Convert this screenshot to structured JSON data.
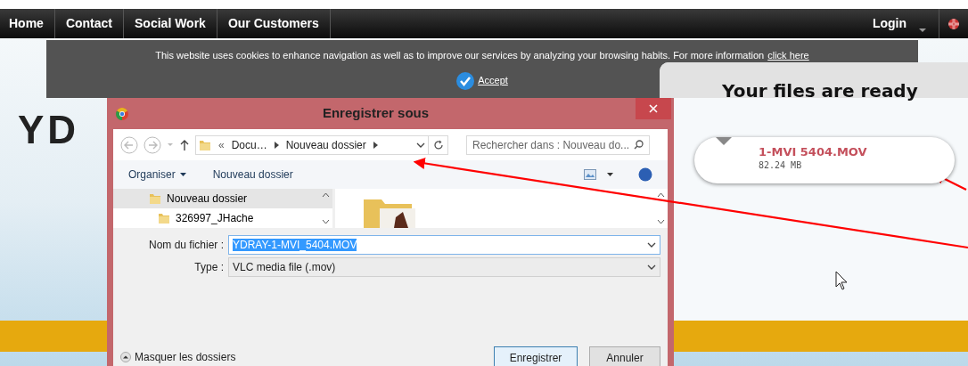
{
  "nav": {
    "items": [
      {
        "label": "Home"
      },
      {
        "label": "Contact"
      },
      {
        "label": "Social Work"
      },
      {
        "label": "Our Customers"
      }
    ],
    "login": "Login"
  },
  "logo": {
    "text": "YD"
  },
  "cookie_banner": {
    "text": "This website uses cookies to enhance navigation as well as to improve our services by analyzing your browsing habits. For more information",
    "link": "click here",
    "accept": "Accept"
  },
  "download_card": {
    "title": "Your files are ready",
    "file_name": "1-MVI 5404.MOV",
    "size": "82.24 MB"
  },
  "dialog": {
    "title": "Enregistrer sous",
    "address_bar": {
      "overflow": "«",
      "path": [
        "Docu…",
        "Nouveau dossier"
      ]
    },
    "search": {
      "placeholder": "Rechercher dans : Nouveau do..."
    },
    "toolbar": {
      "organize": "Organiser",
      "new_folder": "Nouveau dossier"
    },
    "tree": [
      {
        "label": "Nouveau dossier",
        "selected": true,
        "children": [
          {
            "label": "326997_JHache",
            "selected": false
          }
        ]
      }
    ],
    "fields": [
      {
        "label": "Nom du fichier :",
        "value": "YDRAY-1-MVI_5404.MOV",
        "focused": true
      },
      {
        "label": "Type :",
        "value": "VLC media file (.mov)",
        "focused": false
      }
    ],
    "hide_folders": "Masquer les dossiers",
    "buttons": [
      {
        "label": "Enregistrer",
        "kind": "default"
      },
      {
        "label": "Annuler",
        "kind": "normal"
      }
    ]
  }
}
